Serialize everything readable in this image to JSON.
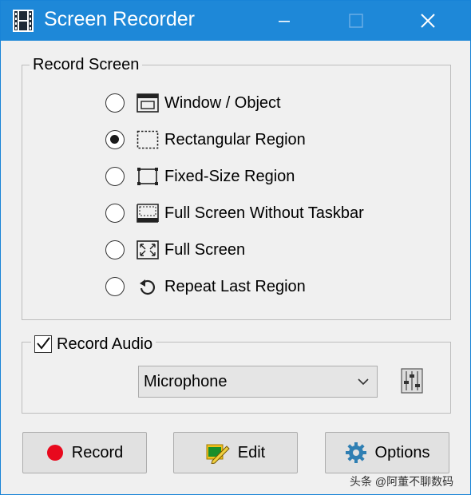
{
  "window": {
    "title": "Screen Recorder",
    "accent_color": "#1e88d8",
    "icons": {
      "app": "film-strip-icon",
      "minimize": "minimize-icon",
      "maximize": "maximize-icon",
      "close": "close-icon"
    }
  },
  "record_screen": {
    "label": "Record Screen",
    "options": [
      {
        "label": "Window / Object",
        "icon": "window-icon",
        "selected": false
      },
      {
        "label": "Rectangular Region",
        "icon": "dashed-rectangle-icon",
        "selected": true
      },
      {
        "label": "Fixed-Size Region",
        "icon": "fixed-region-icon",
        "selected": false
      },
      {
        "label": "Full Screen Without Taskbar",
        "icon": "screen-without-taskbar-icon",
        "selected": false
      },
      {
        "label": "Full Screen",
        "icon": "fullscreen-icon",
        "selected": false
      },
      {
        "label": "Repeat Last Region",
        "icon": "repeat-icon",
        "selected": false
      }
    ]
  },
  "record_audio": {
    "label": "Record Audio",
    "checked": true,
    "source": {
      "value": "Microphone"
    },
    "mixer_icon": "volume-mixer-icon"
  },
  "buttons": {
    "record": {
      "label": "Record",
      "icon": "red-dot-icon",
      "color": "#e8091d"
    },
    "edit": {
      "label": "Edit",
      "icon": "edit-icon"
    },
    "options": {
      "label": "Options",
      "icon": "gear-icon"
    }
  },
  "watermark": "头条 @阿董不聊数码"
}
